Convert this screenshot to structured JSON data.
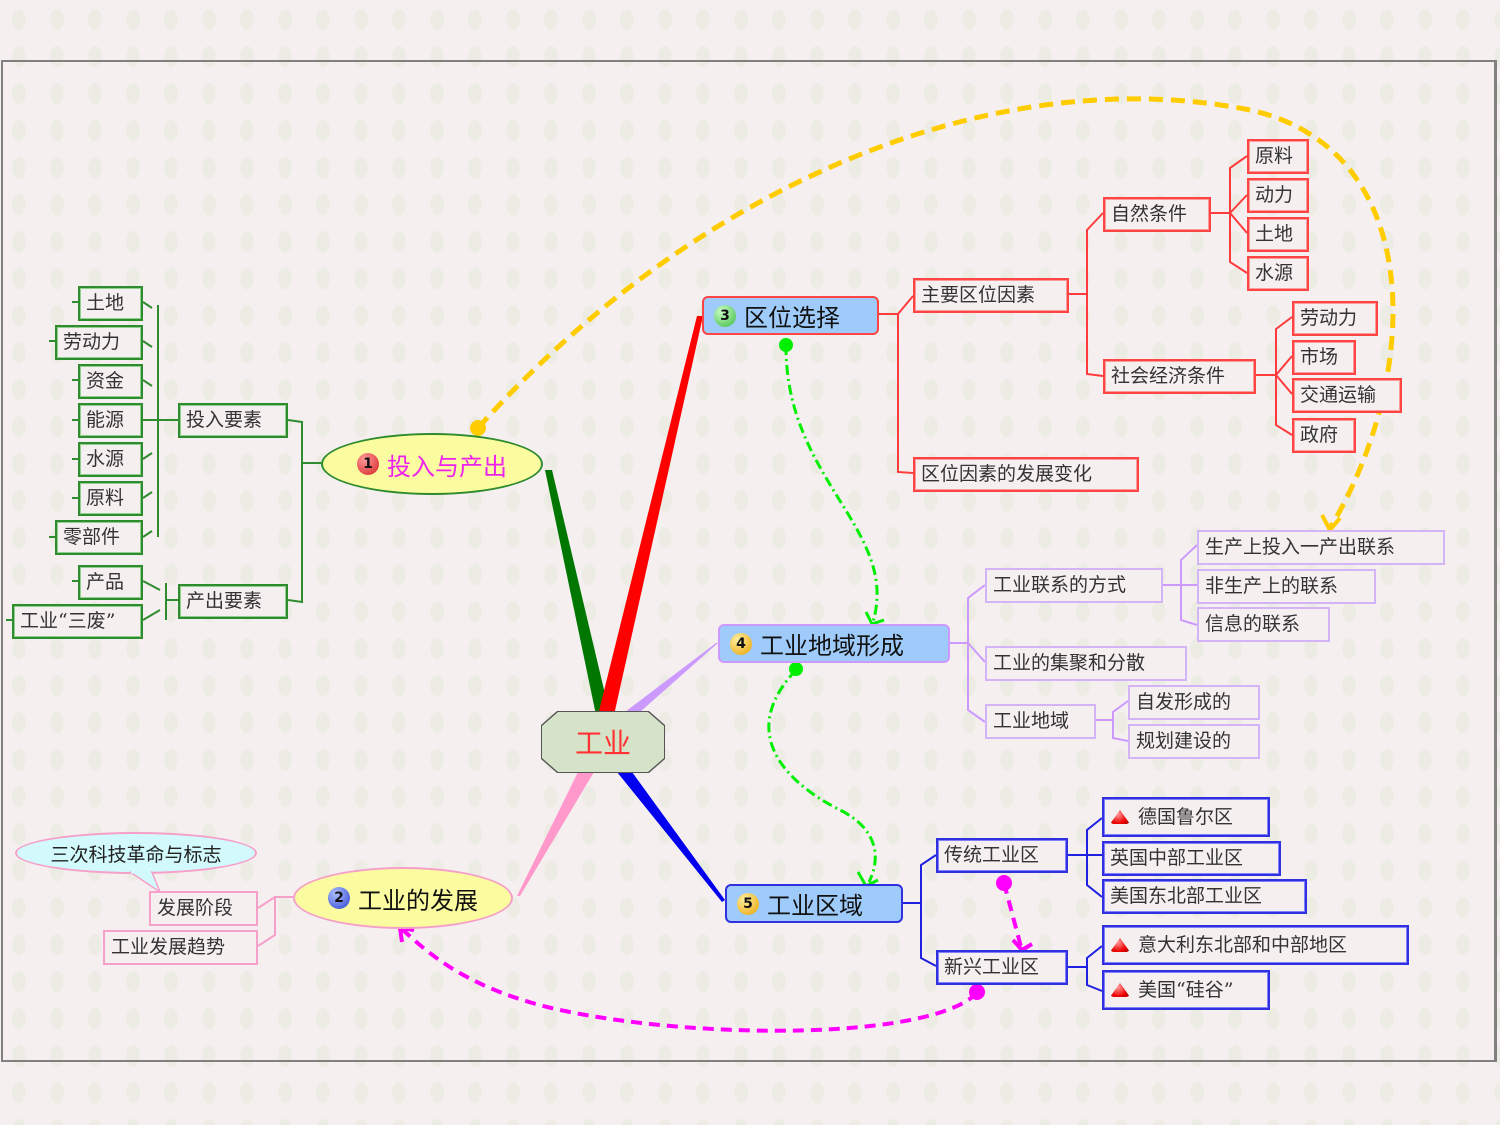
{
  "center": {
    "label": "工业",
    "color": "#ff3333"
  },
  "branches": {
    "b1": {
      "number": "1",
      "label": "投入与产出",
      "label_color": "#ee22ee",
      "branch_color": "#007700",
      "children": [
        {
          "label": "投入要素",
          "children": [
            "土地",
            "劳动力",
            "资金",
            "能源",
            "水源",
            "原料",
            "零部件"
          ]
        },
        {
          "label": "产出要素",
          "children": [
            "产品",
            "工业“三废”"
          ]
        }
      ]
    },
    "b2": {
      "number": "2",
      "label": "工业的发展",
      "branch_color": "#ff99cc",
      "children": [
        {
          "label": "发展阶段",
          "callout": "三次科技革命与标志"
        },
        {
          "label": "工业发展趋势"
        }
      ]
    },
    "b3": {
      "number": "3",
      "label": "区位选择",
      "branch_color": "#ff0000",
      "children": [
        {
          "label": "主要区位因素",
          "children": [
            {
              "label": "自然条件",
              "children": [
                "原料",
                "动力",
                "土地",
                "水源"
              ]
            },
            {
              "label": "社会经济条件",
              "children": [
                "劳动力",
                "市场",
                "交通运输",
                "政府"
              ]
            }
          ]
        },
        {
          "label": "区位因素的发展变化"
        }
      ]
    },
    "b4": {
      "number": "4",
      "label": "工业地域形成",
      "branch_color": "#cc99ff",
      "children": [
        {
          "label": "工业联系的方式",
          "children": [
            "生产上投入一产出联系",
            "非生产上的联系",
            "信息的联系"
          ]
        },
        {
          "label": "工业的集聚和分散"
        },
        {
          "label": "工业地域",
          "children": [
            "自发形成的",
            "规划建设的"
          ]
        }
      ]
    },
    "b5": {
      "number": "5",
      "label": "工业区域",
      "branch_color": "#0000ee",
      "children": [
        {
          "label": "传统工业区",
          "children": [
            "德国鲁尔区",
            "英国中部工业区",
            "美国东北部工业区"
          ]
        },
        {
          "label": "新兴工业区",
          "children": [
            "意大利东北部和中部地区",
            "美国“硅谷”"
          ]
        }
      ]
    }
  },
  "relationships": [
    {
      "from": "投入与产出",
      "to": "生产上投入一产出联系",
      "color": "#ffcc00",
      "style": "dashed"
    },
    {
      "from": "区位选择",
      "to": "工业地域形成",
      "color": "#00ee00",
      "style": "dash-dot"
    },
    {
      "from": "工业地域形成",
      "to": "工业区域",
      "color": "#00ee00",
      "style": "dash-dot"
    },
    {
      "from": "传统工业区",
      "to": "新兴工业区",
      "color": "#ff00ff",
      "style": "dashed"
    },
    {
      "from": "新兴工业区",
      "to": "工业的发展",
      "color": "#ff00ff",
      "style": "dashed"
    }
  ],
  "icons": {
    "flag": "red-triangle-flag-icon"
  }
}
